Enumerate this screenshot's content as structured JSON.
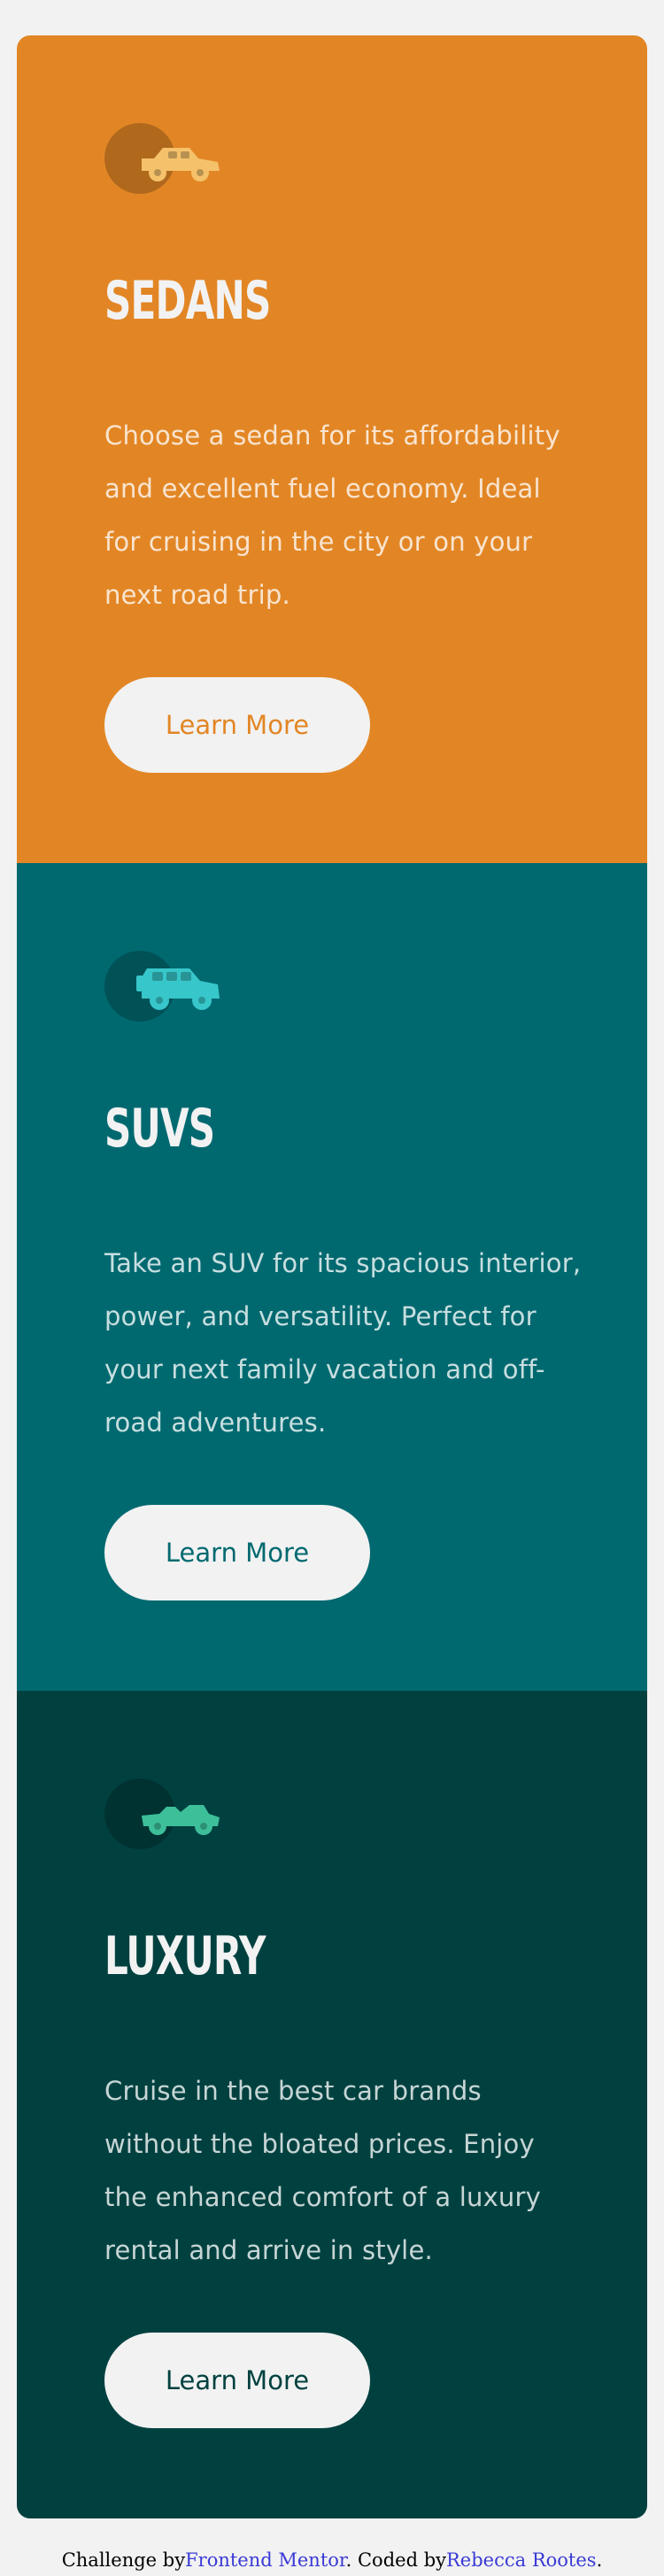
{
  "colors": {
    "background": "#f2f2f2",
    "button_bg": "#f2f2f2",
    "link": "#3a3ad6"
  },
  "cards": [
    {
      "title": "SEDANS",
      "text": "Choose a sedan for its affordability and excellent fuel economy. Ideal for cruising in the city or on your next road trip.",
      "button_label": "Learn More",
      "icon": "sedan-car-icon",
      "bg_color": "#e28625",
      "accent_color": "#e28625",
      "icon_color": "#f5c26b"
    },
    {
      "title": "SUVS",
      "text": "Take an SUV for its spacious interior, power, and versatility. Perfect for your next family vacation and off-road adventures.",
      "button_label": "Learn More",
      "icon": "suv-car-icon",
      "bg_color": "#006970",
      "accent_color": "#006970",
      "icon_color": "#37c6c9"
    },
    {
      "title": "LUXURY",
      "text": "Cruise in the best car brands without the bloated prices. Enjoy the enhanced comfort of a luxury rental and arrive in style.",
      "button_label": "Learn More",
      "icon": "luxury-car-icon",
      "bg_color": "#004140",
      "accent_color": "#004140",
      "icon_color": "#3dbf9a"
    }
  ],
  "footer": {
    "challenge_prefix": "Challenge by",
    "challenge_link": "Frontend Mentor",
    "coded_prefix": ". Coded by",
    "author_link": "Rebecca Rootes",
    "suffix": "."
  }
}
